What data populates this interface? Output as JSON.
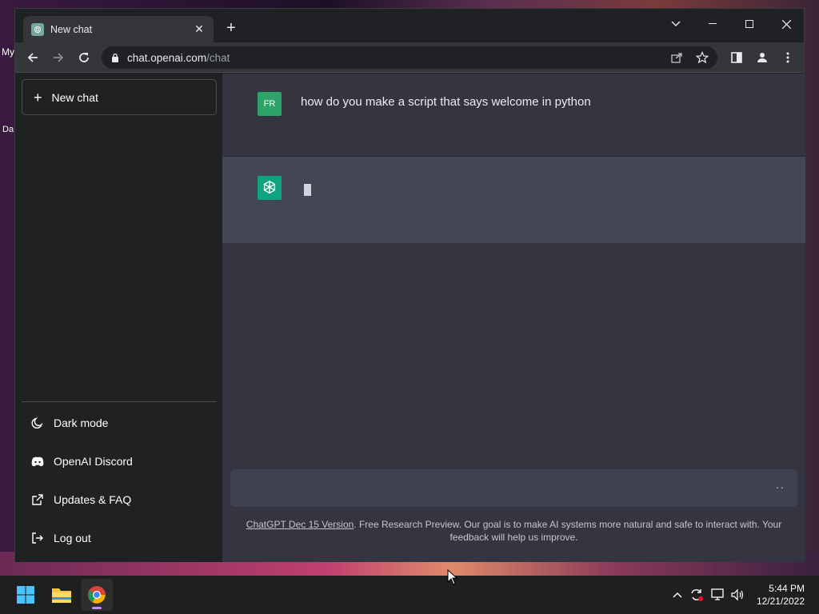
{
  "desktop": {
    "labels": [
      "My",
      "Da"
    ]
  },
  "browser": {
    "tab_title": "New chat",
    "tab_close": "✕",
    "new_tab": "+",
    "url_host": "chat.openai.com",
    "url_path": "/chat",
    "icons": [
      "back-icon",
      "forward-icon",
      "reload-icon",
      "lock-icon",
      "share-icon",
      "star-icon",
      "sidepanel-icon",
      "profile-icon",
      "menu-icon"
    ]
  },
  "sidebar": {
    "new_chat": "New chat",
    "items": [
      {
        "label": "Dark mode",
        "icon": "moon-icon"
      },
      {
        "label": "OpenAI Discord",
        "icon": "discord-icon"
      },
      {
        "label": "Updates & FAQ",
        "icon": "external-link-icon"
      },
      {
        "label": "Log out",
        "icon": "logout-icon"
      }
    ]
  },
  "chat": {
    "user_avatar": "FR",
    "user_message": "how do you make a script that says welcome in python",
    "input_indicator": "··"
  },
  "footer": {
    "link": "ChatGPT Dec 15 Version",
    "text": ". Free Research Preview. Our goal is to make AI systems more natural and safe to interact with. Your feedback will help us improve."
  },
  "taskbar": {
    "time": "5:44 PM",
    "date": "12/21/2022"
  },
  "colors": {
    "sidebar_bg": "#202123",
    "main_bg": "#343541",
    "bot_row_bg": "#444654",
    "user_avatar": "#2ea36a",
    "bot_avatar": "#10a37f"
  }
}
